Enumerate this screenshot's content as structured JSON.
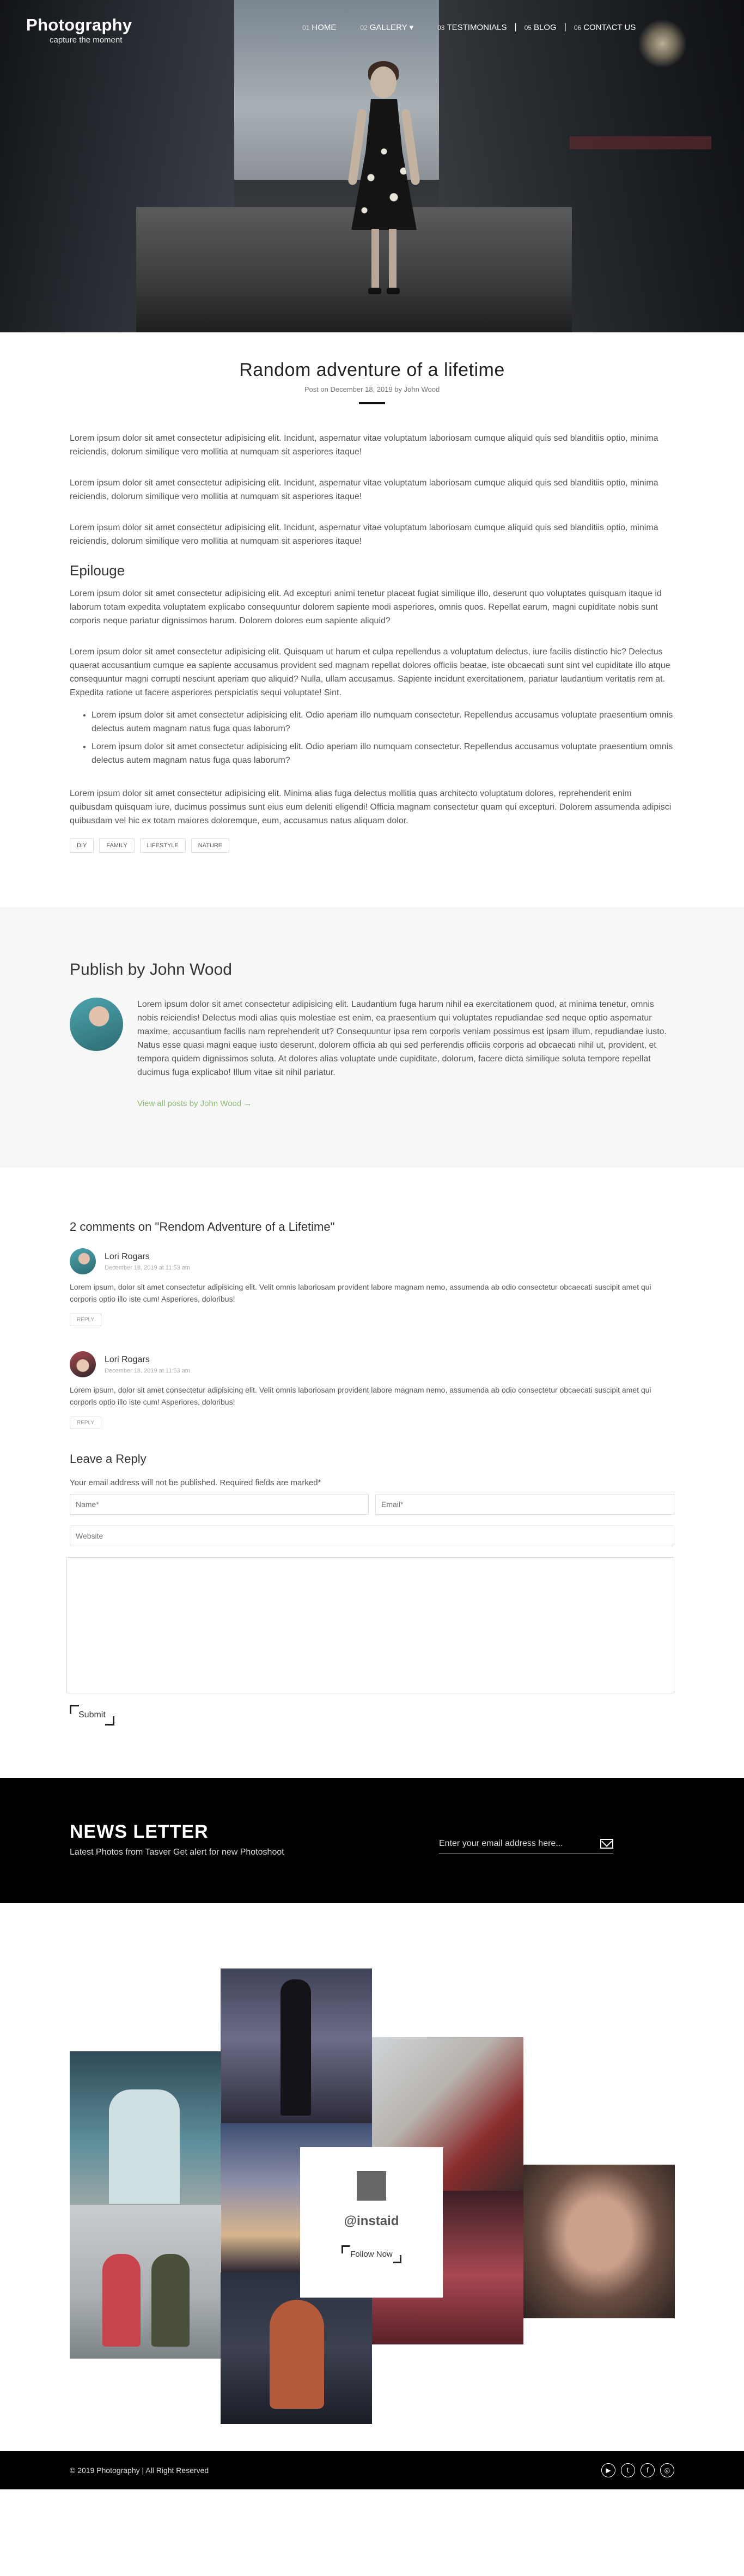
{
  "brand": {
    "name": "Photography",
    "tagline": "capture the moment"
  },
  "nav": [
    {
      "num": "01",
      "label": "HOME"
    },
    {
      "num": "02",
      "label": "GALLERY"
    },
    {
      "num": "03",
      "label": "TESTIMONIALS"
    },
    {
      "num": "05",
      "label": "BLOG"
    },
    {
      "num": "06",
      "label": "CONTACT US"
    }
  ],
  "article": {
    "title": "Random adventure of a lifetime",
    "meta": "Post on December 18, 2019 by John Wood",
    "paragraphs": [
      "Lorem ipsum dolor sit amet consectetur adipisicing elit. Incidunt, aspernatur vitae voluptatum laboriosam cumque aliquid quis sed blanditiis optio, minima reiciendis, dolorum similique vero mollitia at numquam sit asperiores itaque!",
      "Lorem ipsum dolor sit amet consectetur adipisicing elit. Incidunt, aspernatur vitae voluptatum laboriosam cumque aliquid quis sed blanditiis optio, minima reiciendis, dolorum similique vero mollitia at numquam sit asperiores itaque!",
      "Lorem ipsum dolor sit amet consectetur adipisicing elit. Incidunt, aspernatur vitae voluptatum laboriosam cumque aliquid quis sed blanditiis optio, minima reiciendis, dolorum similique vero mollitia at numquam sit asperiores itaque!"
    ],
    "epilogue_heading": "Epilouge",
    "epilogue_paragraphs": [
      "Lorem ipsum dolor sit amet consectetur adipisicing elit. Ad excepturi animi tenetur placeat fugiat similique illo, deserunt quo voluptates quisquam itaque id laborum totam expedita voluptatem explicabo consequuntur dolorem sapiente modi asperiores, omnis quos. Repellat earum, magni cupiditate nobis sunt corporis neque pariatur dignissimos harum. Dolorem dolores eum sapiente aliquid?",
      "Lorem ipsum dolor sit amet consectetur adipisicing elit. Quisquam ut harum et culpa repellendus a voluptatum delectus, iure facilis distinctio hic? Delectus quaerat accusantium cumque ea sapiente accusamus provident sed magnam repellat dolores officiis beatae, iste obcaecati sunt sint vel cupiditate illo atque consequuntur magni corrupti nesciunt aperiam quo aliquid? Nulla, ullam accusamus. Sapiente incidunt exercitationem, pariatur laudantium veritatis rem at. Expedita ratione ut facere asperiores perspiciatis sequi voluptate! Sint."
    ],
    "bullets": [
      "Lorem ipsum dolor sit amet consectetur adipisicing elit. Odio aperiam illo numquam consectetur. Repellendus accusamus voluptate praesentium omnis delectus autem magnam natus fuga quas laborum?",
      "Lorem ipsum dolor sit amet consectetur adipisicing elit. Odio aperiam illo numquam consectetur. Repellendus accusamus voluptate praesentium omnis delectus autem magnam natus fuga quas laborum?"
    ],
    "closing": "Lorem ipsum dolor sit amet consectetur adipisicing elit. Minima alias fuga delectus mollitia quas architecto voluptatum dolores, reprehenderit enim quibusdam quisquam iure, ducimus possimus sunt eius eum deleniti eligendi! Officia magnam consectetur quam qui excepturi. Dolorem assumenda adipisci quibusdam vel hic ex totam maiores doloremque, eum, accusamus natus aliquam dolor.",
    "tags": [
      "DIY",
      "FAMILY",
      "LIFESTYLE",
      "NATURE"
    ]
  },
  "author": {
    "heading": "Publish by John Wood",
    "bio": "Lorem ipsum dolor sit amet consectetur adipisicing elit. Laudantium fuga harum nihil ea exercitationem quod, at minima tenetur, omnis nobis reiciendis! Delectus modi alias quis molestiae est enim, ea praesentium qui voluptates repudiandae sed neque optio aspernatur maxime, accusantium facilis nam reprehenderit ut? Consequuntur ipsa rem corporis veniam possimus est ipsam illum, repudiandae iusto. Natus esse quasi magni eaque iusto deserunt, dolorem officia ab qui sed perferendis officiis corporis ad obcaecati nihil ut, provident, et tempora quidem dignissimos soluta. At dolores alias voluptate unde cupiditate, dolorum, facere dicta similique soluta tempore repellat ducimus fuga explicabo! Illum vitae sit nihil pariatur.",
    "link": "View all posts by John Wood →"
  },
  "comments": {
    "heading": "2 comments on \"Rendom Adventure of a Lifetime\"",
    "items": [
      {
        "name": "Lori Rogars",
        "date": "December 18, 2019 at 11:53 am",
        "text": "Lorem ipsum, dolor sit amet consectetur adipisicing elit. Velit omnis laboriosam provident labore magnam nemo, assumenda ab odio consectetur obcaecati suscipit amet qui corporis optio illo iste cum! Asperiores, doloribus!",
        "reply": "REPLY"
      },
      {
        "name": "Lori Rogars",
        "date": "December 18, 2019 at 11:53 am",
        "text": "Lorem ipsum, dolor sit amet consectetur adipisicing elit. Velit omnis laboriosam provident labore magnam nemo, assumenda ab odio consectetur obcaecati suscipit amet qui corporis optio illo iste cum! Asperiores, doloribus!",
        "reply": "REPLY"
      }
    ]
  },
  "reply_form": {
    "heading": "Leave a Reply",
    "note": "Your email address will not be published. Required fields are marked*",
    "name_placeholder": "Name*",
    "email_placeholder": "Email*",
    "website_placeholder": "Website",
    "submit": "Submit"
  },
  "newsletter": {
    "heading": "NEWS LETTER",
    "sub": "Latest Photos from Tasver Get alert for new Photoshoot",
    "email_placeholder": "Enter your email address here...",
    "icon": "mail-icon"
  },
  "instagram": {
    "handle": "@instaid",
    "follow": "Follow Now",
    "icon": "instagram-icon"
  },
  "footer": {
    "copyright": "© 2019 Photography | All Right Reserved",
    "socials": [
      {
        "name": "youtube-icon",
        "glyph": "▶"
      },
      {
        "name": "twitter-icon",
        "glyph": "t"
      },
      {
        "name": "facebook-icon",
        "glyph": "f"
      },
      {
        "name": "instagram-icon",
        "glyph": "◎"
      }
    ]
  }
}
